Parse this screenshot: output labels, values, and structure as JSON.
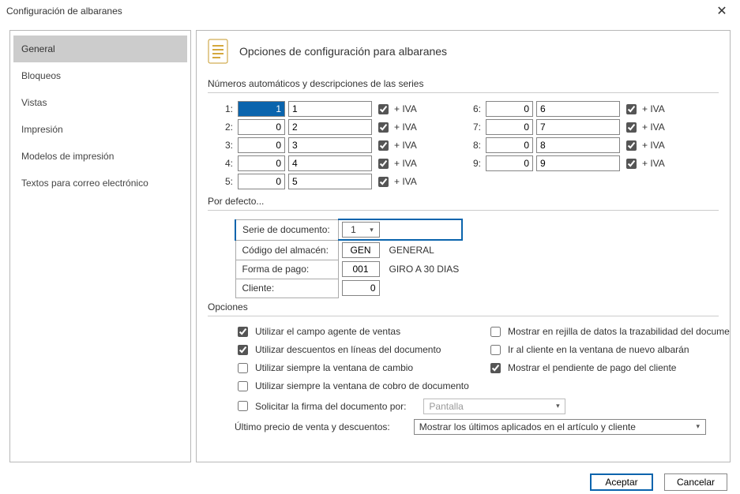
{
  "window": {
    "title": "Configuración de albaranes",
    "close_icon": "✕"
  },
  "sidebar": {
    "items": [
      {
        "label": "General",
        "active": true
      },
      {
        "label": "Bloqueos",
        "active": false
      },
      {
        "label": "Vistas",
        "active": false
      },
      {
        "label": "Impresión",
        "active": false
      },
      {
        "label": "Modelos de impresión",
        "active": false
      },
      {
        "label": "Textos para correo electrónico",
        "active": false
      }
    ]
  },
  "header": {
    "title": "Opciones de configuración para albaranes"
  },
  "sections": {
    "series_heading": "Números automáticos y descripciones de las series",
    "defaults_heading": "Por defecto...",
    "options_heading": "Opciones"
  },
  "series": {
    "iva_label": "+ IVA",
    "rows": [
      {
        "idx": "1:",
        "num": "1",
        "desc": "1",
        "iva": true,
        "sel": true
      },
      {
        "idx": "2:",
        "num": "0",
        "desc": "2",
        "iva": true
      },
      {
        "idx": "3:",
        "num": "0",
        "desc": "3",
        "iva": true
      },
      {
        "idx": "4:",
        "num": "0",
        "desc": "4",
        "iva": true
      },
      {
        "idx": "5:",
        "num": "0",
        "desc": "5",
        "iva": true
      },
      {
        "idx": "6:",
        "num": "0",
        "desc": "6",
        "iva": true
      },
      {
        "idx": "7:",
        "num": "0",
        "desc": "7",
        "iva": true
      },
      {
        "idx": "8:",
        "num": "0",
        "desc": "8",
        "iva": true
      },
      {
        "idx": "9:",
        "num": "0",
        "desc": "9",
        "iva": true
      }
    ]
  },
  "defaults": {
    "rows": [
      {
        "label": "Serie de documento:",
        "code": "1",
        "type": "select",
        "desc": ""
      },
      {
        "label": "Código del almacén:",
        "code": "GEN",
        "type": "text",
        "desc": "GENERAL"
      },
      {
        "label": "Forma de pago:",
        "code": "001",
        "type": "text",
        "desc": "GIRO A 30 DIAS"
      },
      {
        "label": "Cliente:",
        "code": "0",
        "type": "number",
        "desc": ""
      }
    ]
  },
  "options": {
    "left": [
      {
        "label": "Utilizar el campo agente de ventas",
        "checked": true
      },
      {
        "label": "Utilizar descuentos en líneas del documento",
        "checked": true
      },
      {
        "label": "Utilizar siempre la ventana de cambio",
        "checked": false
      },
      {
        "label": "Utilizar siempre la ventana de cobro de documento",
        "checked": false
      }
    ],
    "right": [
      {
        "label": "Mostrar en rejilla de datos la trazabilidad del documento",
        "checked": false
      },
      {
        "label": "Ir al cliente en la ventana de nuevo albarán",
        "checked": false
      },
      {
        "label": "Mostrar el pendiente de pago del cliente",
        "checked": true
      }
    ],
    "sign_label": "Solicitar la firma del documento por:",
    "sign_value": "Pantalla",
    "sign_checked": false,
    "lastprice_label": "Último precio de venta y descuentos:",
    "lastprice_value": "Mostrar los últimos aplicados en el artículo y cliente"
  },
  "buttons": {
    "accept": "Aceptar",
    "cancel": "Cancelar"
  }
}
